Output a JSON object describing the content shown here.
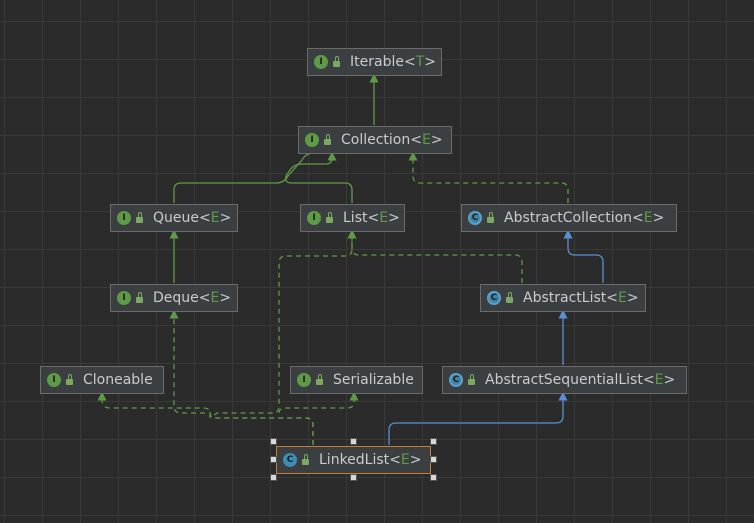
{
  "nodes": [
    {
      "id": "iterable",
      "kind": "I",
      "type": "interface",
      "name": "Iterable",
      "type_param": "T"
    },
    {
      "id": "collection",
      "kind": "I",
      "type": "interface",
      "name": "Collection",
      "type_param": "E"
    },
    {
      "id": "queue",
      "kind": "I",
      "type": "interface",
      "name": "Queue",
      "type_param": "E"
    },
    {
      "id": "list",
      "kind": "I",
      "type": "interface",
      "name": "List",
      "type_param": "E"
    },
    {
      "id": "abstract-collection",
      "kind": "C",
      "type": "abstract class",
      "name": "AbstractCollection",
      "type_param": "E"
    },
    {
      "id": "deque",
      "kind": "I",
      "type": "interface",
      "name": "Deque",
      "type_param": "E"
    },
    {
      "id": "abstract-list",
      "kind": "C",
      "type": "abstract class",
      "name": "AbstractList",
      "type_param": "E"
    },
    {
      "id": "cloneable",
      "kind": "I",
      "type": "interface",
      "name": "Cloneable",
      "type_param": ""
    },
    {
      "id": "serializable",
      "kind": "I",
      "type": "interface",
      "name": "Serializable",
      "type_param": ""
    },
    {
      "id": "abstract-sequential-list",
      "kind": "C",
      "type": "abstract class",
      "name": "AbstractSequentialList",
      "type_param": "E"
    },
    {
      "id": "linked-list",
      "kind": "C",
      "type": "class",
      "name": "LinkedList",
      "type_param": "E",
      "selected": true
    }
  ],
  "edges": [
    {
      "from": "collection",
      "to": "iterable",
      "relation": "extends"
    },
    {
      "from": "queue",
      "to": "collection",
      "relation": "extends"
    },
    {
      "from": "list",
      "to": "collection",
      "relation": "extends"
    },
    {
      "from": "abstract-collection",
      "to": "collection",
      "relation": "implements"
    },
    {
      "from": "deque",
      "to": "queue",
      "relation": "extends"
    },
    {
      "from": "abstract-list",
      "to": "abstract-collection",
      "relation": "extends"
    },
    {
      "from": "abstract-list",
      "to": "list",
      "relation": "implements"
    },
    {
      "from": "abstract-sequential-list",
      "to": "abstract-list",
      "relation": "extends"
    },
    {
      "from": "linked-list",
      "to": "abstract-sequential-list",
      "relation": "extends"
    },
    {
      "from": "linked-list",
      "to": "deque",
      "relation": "implements"
    },
    {
      "from": "linked-list",
      "to": "list",
      "relation": "implements"
    },
    {
      "from": "linked-list",
      "to": "cloneable",
      "relation": "implements"
    },
    {
      "from": "linked-list",
      "to": "serializable",
      "relation": "implements"
    }
  ],
  "colors": {
    "interface_edge": "#5f9a47",
    "class_edge": "#5a8fd6",
    "selected_border": "#c57c35"
  }
}
